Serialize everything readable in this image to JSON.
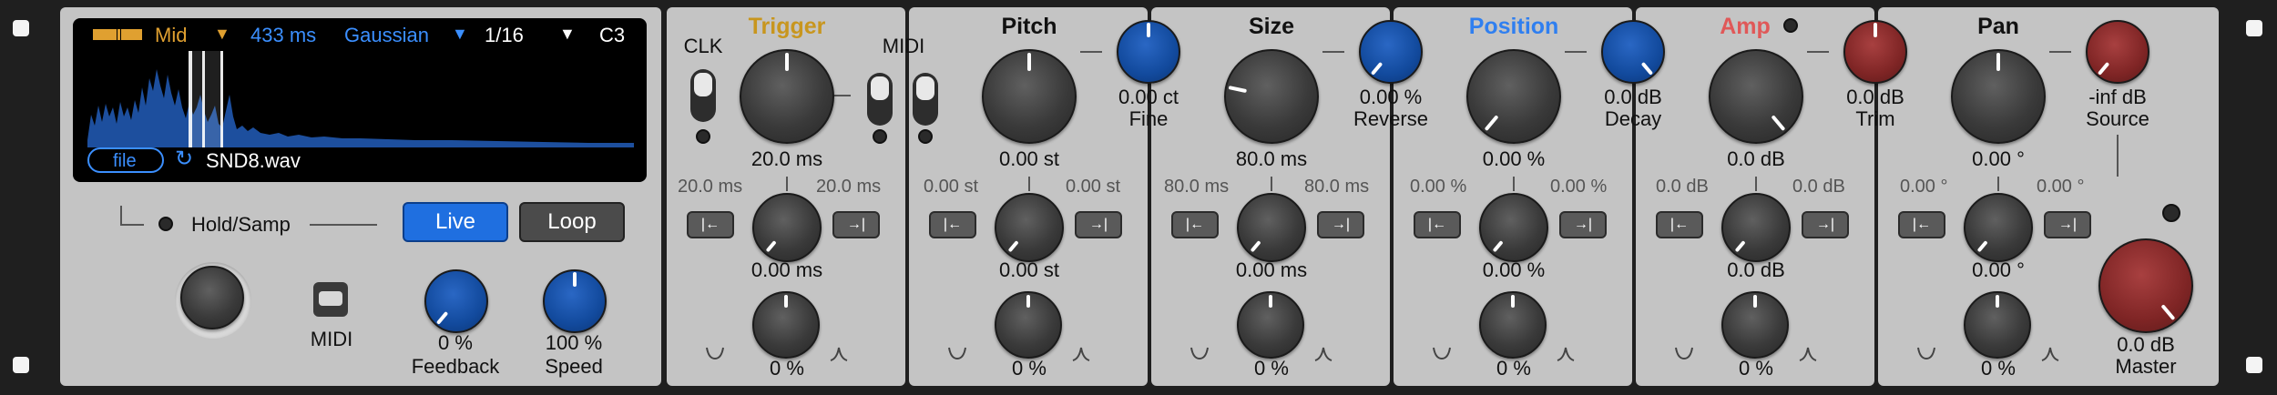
{
  "display": {
    "mode": "Mid",
    "time": "433 ms",
    "window": "Gaussian",
    "division": "1/16",
    "note": "C3",
    "file_button": "file",
    "filename": "SND8.wav"
  },
  "left": {
    "hold_label": "Hold/Samp",
    "live_label": "Live",
    "loop_label": "Loop",
    "midi_label": "MIDI",
    "feedback_value": "0 %",
    "feedback_label": "Feedback",
    "speed_value": "100 %",
    "speed_label": "Speed"
  },
  "labels": {
    "clk": "CLK",
    "midi": "MIDI"
  },
  "columns": [
    {
      "title": "Trigger",
      "value": "20.0 ms",
      "range_min": "20.0 ms",
      "range_max": "20.0 ms",
      "mod_value": "0.00 ms",
      "bottom_value": "0 %"
    },
    {
      "title": "Pitch",
      "value": "0.00 st",
      "range_min": "0.00 st",
      "range_max": "0.00 st",
      "mod_value": "0.00 st",
      "bottom_value": "0 %",
      "side_value": "0.00 ct",
      "side_label": "Fine"
    },
    {
      "title": "Size",
      "value": "80.0 ms",
      "range_min": "80.0 ms",
      "range_max": "80.0 ms",
      "mod_value": "0.00 ms",
      "bottom_value": "0 %",
      "side_value": "0.00 %",
      "side_label": "Reverse"
    },
    {
      "title": "Position",
      "value": "0.00 %",
      "range_min": "0.00 %",
      "range_max": "0.00 %",
      "mod_value": "0.00 %",
      "bottom_value": "0 %",
      "side_value": "0.0 dB",
      "side_label": "Decay"
    },
    {
      "title": "Amp",
      "value": "0.0 dB",
      "range_min": "0.0 dB",
      "range_max": "0.0 dB",
      "mod_value": "0.0 dB",
      "bottom_value": "0 %",
      "side_value": "0.0 dB",
      "side_label": "Trim"
    },
    {
      "title": "Pan",
      "value": "0.00 °",
      "range_min": "0.00 °",
      "range_max": "0.00 °",
      "mod_value": "0.00 °",
      "bottom_value": "0 %",
      "side_value": "-inf dB",
      "side_label": "Source"
    }
  ],
  "master": {
    "value": "0.0 dB",
    "label": "Master"
  },
  "colors": {
    "trigger": "#c8961e",
    "position": "#2f7ff0",
    "amp": "#e05858",
    "lcd_orange": "#e0a030",
    "lcd_blue": "#3b8fff"
  },
  "icons": {
    "env_down": "curve-down-icon",
    "env_up": "curve-up-icon",
    "arrow_left": "arrow-left-icon",
    "arrow_right": "arrow-right-icon",
    "refresh": "refresh-icon"
  }
}
